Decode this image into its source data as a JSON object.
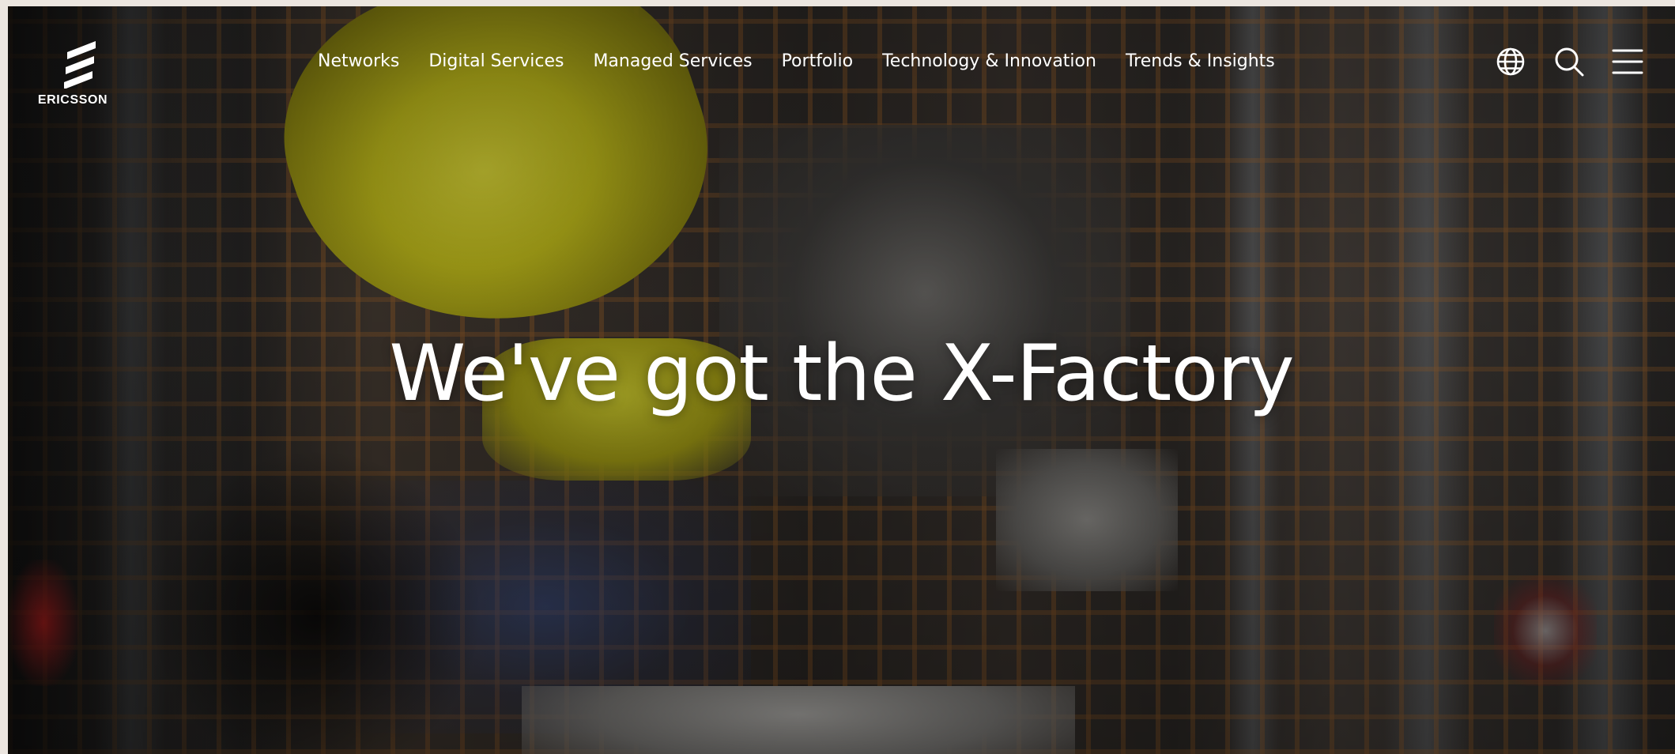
{
  "brand": {
    "name": "ERICSSON"
  },
  "nav": {
    "items": [
      {
        "label": "Networks"
      },
      {
        "label": "Digital Services"
      },
      {
        "label": "Managed Services"
      },
      {
        "label": "Portfolio"
      },
      {
        "label": "Technology & Innovation"
      },
      {
        "label": "Trends & Insights"
      }
    ]
  },
  "header_icons": [
    "globe-icon",
    "search-icon",
    "menu-icon"
  ],
  "hero": {
    "title": "We've got the X-Factory"
  },
  "colors": {
    "text": "#ffffff",
    "accent_yellow": "#d8d630",
    "grid_orange": "#cd7828"
  }
}
